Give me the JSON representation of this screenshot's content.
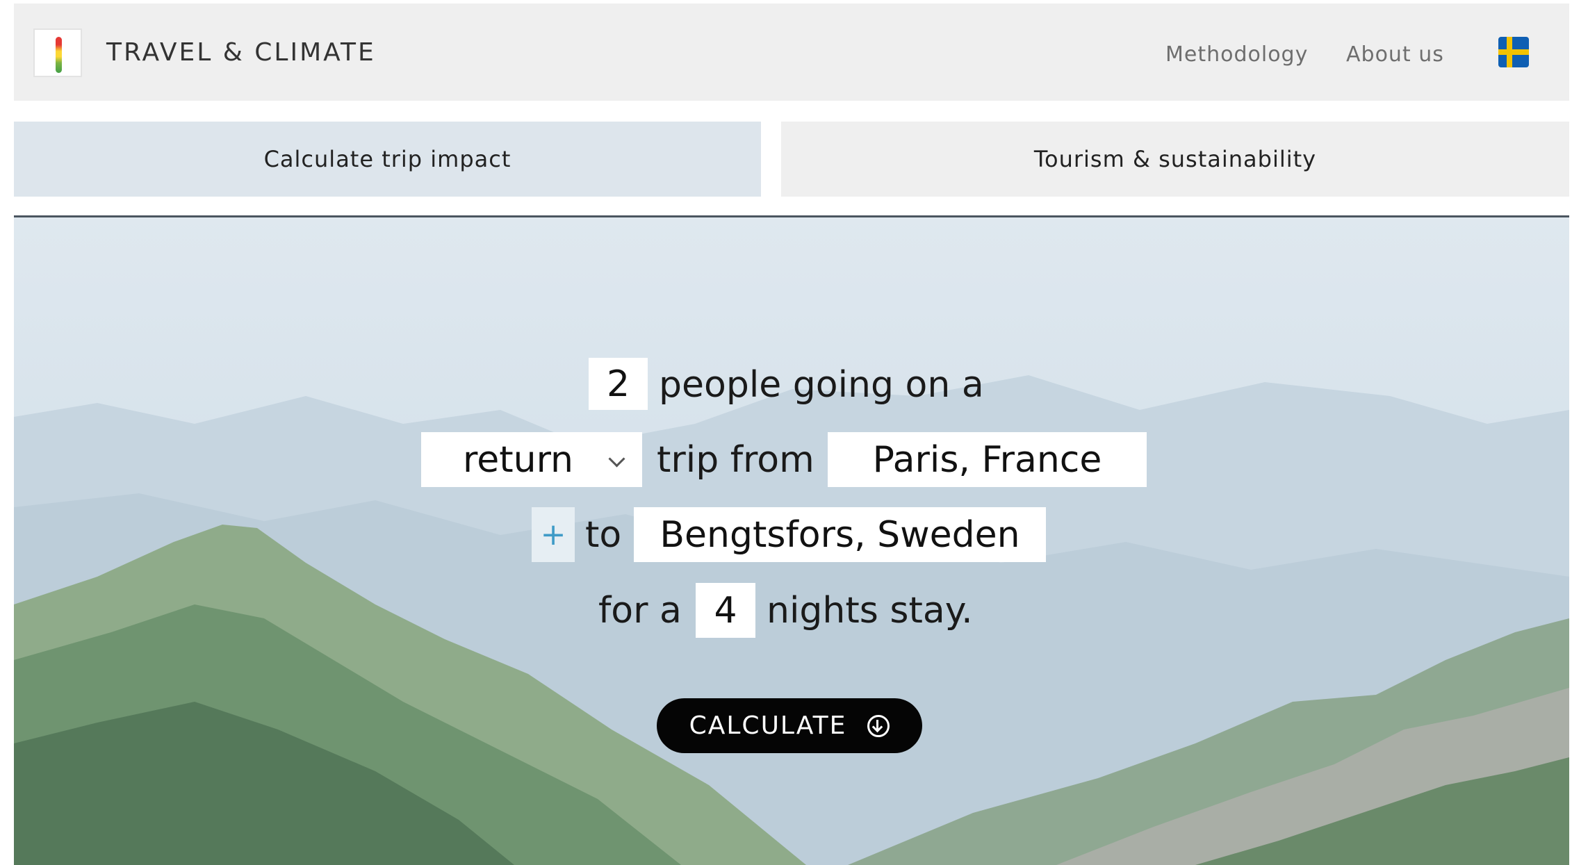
{
  "header": {
    "brand": "TRAVEL & CLIMATE",
    "nav": {
      "methodology": "Methodology",
      "about": "About us"
    },
    "language_flag": "sweden-flag-icon"
  },
  "tabs": {
    "calculate": "Calculate trip impact",
    "tourism": "Tourism & sustainability"
  },
  "form": {
    "people_count": "2",
    "people_text": "people going on a",
    "trip_type": "return",
    "trip_from_text": "trip from",
    "origin": "Paris, France",
    "add_stop": "+",
    "to_text": "to",
    "destination": "Bengtsfors, Sweden",
    "for_a_text": "for a",
    "nights": "4",
    "nights_text": "nights stay."
  },
  "calculate_button": "CALCULATE",
  "colors": {
    "header_bg": "#efefef",
    "active_tab_bg": "#dde5ec",
    "button_bg": "#050505",
    "plus_accent": "#3f9bc7"
  }
}
